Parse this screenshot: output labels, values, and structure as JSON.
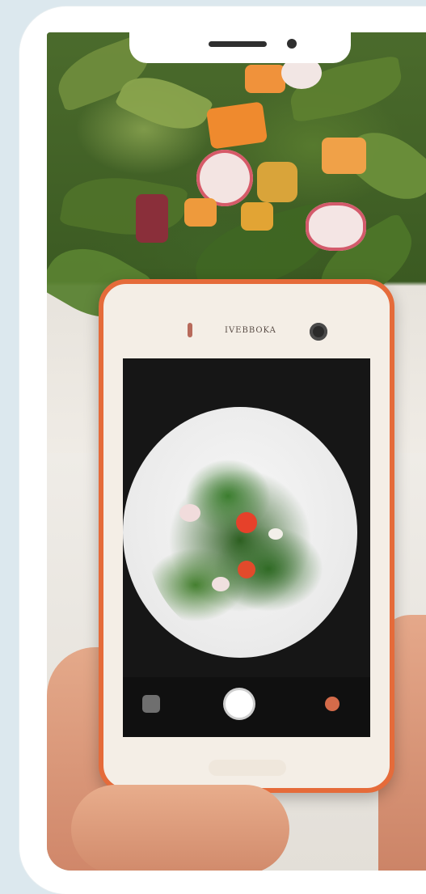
{
  "phone_mockup": {
    "frame_color": "#ffffff",
    "background_color": "#dce8ee"
  },
  "photo": {
    "subject": "salad",
    "held_phone": {
      "brand_text": "IVEBBOKA",
      "frame_color": "#e56b3a",
      "camera_ui": {
        "gallery_icon": "gallery-icon",
        "shutter_icon": "shutter-icon",
        "switch_icon": "camera-switch-icon"
      }
    }
  }
}
